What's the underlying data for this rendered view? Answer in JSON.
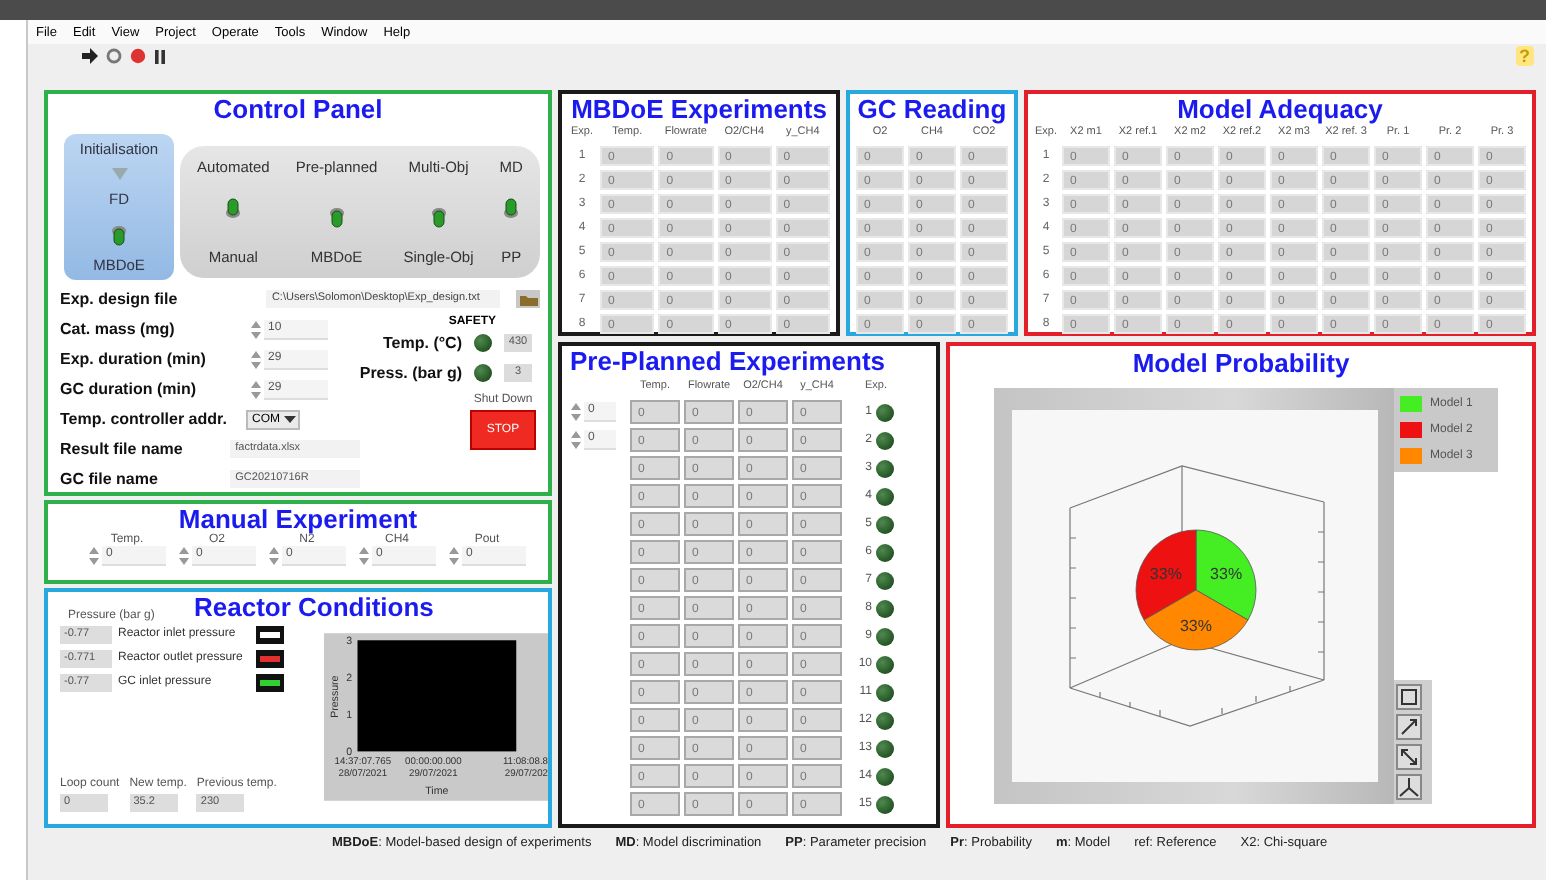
{
  "menu": [
    "File",
    "Edit",
    "View",
    "Project",
    "Operate",
    "Tools",
    "Window",
    "Help"
  ],
  "help_icon": "?",
  "control_panel": {
    "title": "Control Panel",
    "init_switch": {
      "label": "Initialisation",
      "top": "FD",
      "bottom": "MBDoE",
      "up": false
    },
    "switches": [
      {
        "top": "Automated",
        "bottom": "Manual",
        "up": true
      },
      {
        "top": "Pre-planned",
        "bottom": "MBDoE",
        "up": false
      },
      {
        "top": "Multi-Obj",
        "bottom": "Single-Obj",
        "up": false
      },
      {
        "top": "MD",
        "bottom": "PP",
        "up": true
      }
    ],
    "design_file": {
      "label": "Exp. design file",
      "value": "C:\\Users\\Solomon\\Desktop\\Exp_design.txt"
    },
    "numeric": [
      {
        "label": "Cat. mass (mg)",
        "value": "10"
      },
      {
        "label": "Exp. duration (min)",
        "value": "29"
      },
      {
        "label": "GC duration (min)",
        "value": "29"
      }
    ],
    "safety": {
      "title": "SAFETY",
      "items": [
        {
          "label": "Temp. (°C)",
          "on": false,
          "value": "430"
        },
        {
          "label": "Press. (bar g)",
          "on": false,
          "value": "3"
        }
      ]
    },
    "controller": {
      "label": "Temp. controller addr.",
      "value": "COM"
    },
    "files": [
      {
        "label": "Result file name",
        "value": "factrdata.xlsx"
      },
      {
        "label": "GC  file name",
        "value": "GC20210716R"
      }
    ],
    "shutdown": {
      "label": "Shut Down",
      "button": "STOP"
    }
  },
  "manual_experiment": {
    "title": "Manual Experiment",
    "inputs": [
      {
        "label": "Temp.",
        "value": "0"
      },
      {
        "label": "O2",
        "value": "0"
      },
      {
        "label": "N2",
        "value": "0"
      },
      {
        "label": "CH4",
        "value": "0"
      },
      {
        "label": "Pout",
        "value": "0"
      }
    ]
  },
  "reactor_conditions": {
    "title": "Reactor Conditions",
    "legend_title": "Pressure (bar g)",
    "plots": [
      {
        "value": "-0.77",
        "name": "Reactor inlet pressure",
        "color": "#ffffff"
      },
      {
        "value": "-0.771",
        "name": "Reactor outlet pressure",
        "color": "#e03030"
      },
      {
        "value": "-0.77",
        "name": "GC inlet pressure",
        "color": "#30d030"
      }
    ],
    "graph": {
      "ylabel": "Pressure",
      "xlabel": "Time",
      "yticks": [
        "3",
        "2",
        "1",
        "0"
      ],
      "xticks": [
        {
          "time": "14:37:07.765",
          "date": "28/07/2021"
        },
        {
          "time": "00:00:00.000",
          "date": "29/07/2021"
        },
        {
          "time": "11:08:08.8",
          "date": "29/07/202"
        }
      ]
    },
    "readouts": [
      {
        "label": "Loop count",
        "value": "0"
      },
      {
        "label": "New temp.",
        "value": "35.2"
      },
      {
        "label": "Previous temp.",
        "value": "230"
      }
    ]
  },
  "mbdoe_experiments": {
    "title": "MBDoE Experiments",
    "columns": [
      "Exp.",
      "Temp.",
      "Flowrate",
      "O2/CH4",
      "y_CH4"
    ],
    "rows": [
      [
        "1",
        "0",
        "0",
        "0",
        "0"
      ],
      [
        "2",
        "0",
        "0",
        "0",
        "0"
      ],
      [
        "3",
        "0",
        "0",
        "0",
        "0"
      ],
      [
        "4",
        "0",
        "0",
        "0",
        "0"
      ],
      [
        "5",
        "0",
        "0",
        "0",
        "0"
      ],
      [
        "6",
        "0",
        "0",
        "0",
        "0"
      ],
      [
        "7",
        "0",
        "0",
        "0",
        "0"
      ],
      [
        "8",
        "0",
        "0",
        "0",
        "0"
      ]
    ]
  },
  "gc_reading": {
    "title": "GC Reading",
    "columns": [
      "O2",
      "CH4",
      "CO2"
    ],
    "rows": [
      [
        "0",
        "0",
        "0"
      ],
      [
        "0",
        "0",
        "0"
      ],
      [
        "0",
        "0",
        "0"
      ],
      [
        "0",
        "0",
        "0"
      ],
      [
        "0",
        "0",
        "0"
      ],
      [
        "0",
        "0",
        "0"
      ],
      [
        "0",
        "0",
        "0"
      ],
      [
        "0",
        "0",
        "0"
      ]
    ]
  },
  "model_adequacy": {
    "title": "Model Adequacy",
    "columns": [
      "Exp.",
      "X2 m1",
      "X2 ref.1",
      "X2 m2",
      "X2 ref.2",
      "X2 m3",
      "X2 ref. 3",
      "Pr. 1",
      "Pr. 2",
      "Pr. 3"
    ],
    "rows": [
      [
        "1",
        "0",
        "0",
        "0",
        "0",
        "0",
        "0",
        "0",
        "0",
        "0"
      ],
      [
        "2",
        "0",
        "0",
        "0",
        "0",
        "0",
        "0",
        "0",
        "0",
        "0"
      ],
      [
        "3",
        "0",
        "0",
        "0",
        "0",
        "0",
        "0",
        "0",
        "0",
        "0"
      ],
      [
        "4",
        "0",
        "0",
        "0",
        "0",
        "0",
        "0",
        "0",
        "0",
        "0"
      ],
      [
        "5",
        "0",
        "0",
        "0",
        "0",
        "0",
        "0",
        "0",
        "0",
        "0"
      ],
      [
        "6",
        "0",
        "0",
        "0",
        "0",
        "0",
        "0",
        "0",
        "0",
        "0"
      ],
      [
        "7",
        "0",
        "0",
        "0",
        "0",
        "0",
        "0",
        "0",
        "0",
        "0"
      ],
      [
        "8",
        "0",
        "0",
        "0",
        "0",
        "0",
        "0",
        "0",
        "0",
        "0"
      ]
    ]
  },
  "pre_planned": {
    "title": "Pre-Planned Experiments",
    "index_controls": [
      "0",
      "0"
    ],
    "columns": [
      "Temp.",
      "Flowrate",
      "O2/CH4",
      "y_CH4",
      "Exp."
    ],
    "rows": [
      {
        "cells": [
          "0",
          "0",
          "0",
          "0"
        ],
        "exp": "1",
        "on": false
      },
      {
        "cells": [
          "0",
          "0",
          "0",
          "0"
        ],
        "exp": "2",
        "on": false
      },
      {
        "cells": [
          "0",
          "0",
          "0",
          "0"
        ],
        "exp": "3",
        "on": false
      },
      {
        "cells": [
          "0",
          "0",
          "0",
          "0"
        ],
        "exp": "4",
        "on": false
      },
      {
        "cells": [
          "0",
          "0",
          "0",
          "0"
        ],
        "exp": "5",
        "on": false
      },
      {
        "cells": [
          "0",
          "0",
          "0",
          "0"
        ],
        "exp": "6",
        "on": false
      },
      {
        "cells": [
          "0",
          "0",
          "0",
          "0"
        ],
        "exp": "7",
        "on": false
      },
      {
        "cells": [
          "0",
          "0",
          "0",
          "0"
        ],
        "exp": "8",
        "on": false
      },
      {
        "cells": [
          "0",
          "0",
          "0",
          "0"
        ],
        "exp": "9",
        "on": false
      },
      {
        "cells": [
          "0",
          "0",
          "0",
          "0"
        ],
        "exp": "10",
        "on": false
      },
      {
        "cells": [
          "0",
          "0",
          "0",
          "0"
        ],
        "exp": "11",
        "on": false
      },
      {
        "cells": [
          "0",
          "0",
          "0",
          "0"
        ],
        "exp": "12",
        "on": false
      },
      {
        "cells": [
          "0",
          "0",
          "0",
          "0"
        ],
        "exp": "13",
        "on": false
      },
      {
        "cells": [
          "0",
          "0",
          "0",
          "0"
        ],
        "exp": "14",
        "on": false
      },
      {
        "cells": [
          "0",
          "0",
          "0",
          "0"
        ],
        "exp": "15",
        "on": false
      }
    ]
  },
  "model_probability": {
    "title": "Model Probability",
    "legend": [
      {
        "color": "#44ee22"
      },
      {
        "color": "#ee1111"
      },
      {
        "color": "#ff8800"
      }
    ],
    "chart_data": {
      "type": "pie",
      "categories": [
        "Model 1",
        "Model 2",
        "Model 3"
      ],
      "values": [
        33,
        33,
        33
      ],
      "value_labels": [
        "33%",
        "33%",
        "33%"
      ]
    }
  },
  "footer": [
    "**MBDoE**: Model-based design of experiments",
    "**MD**: Model discrimination",
    "**PP**: Parameter precision",
    "**Pr**: Probability",
    "**m**: Model",
    "ref: Reference",
    "X2: Chi-square"
  ]
}
